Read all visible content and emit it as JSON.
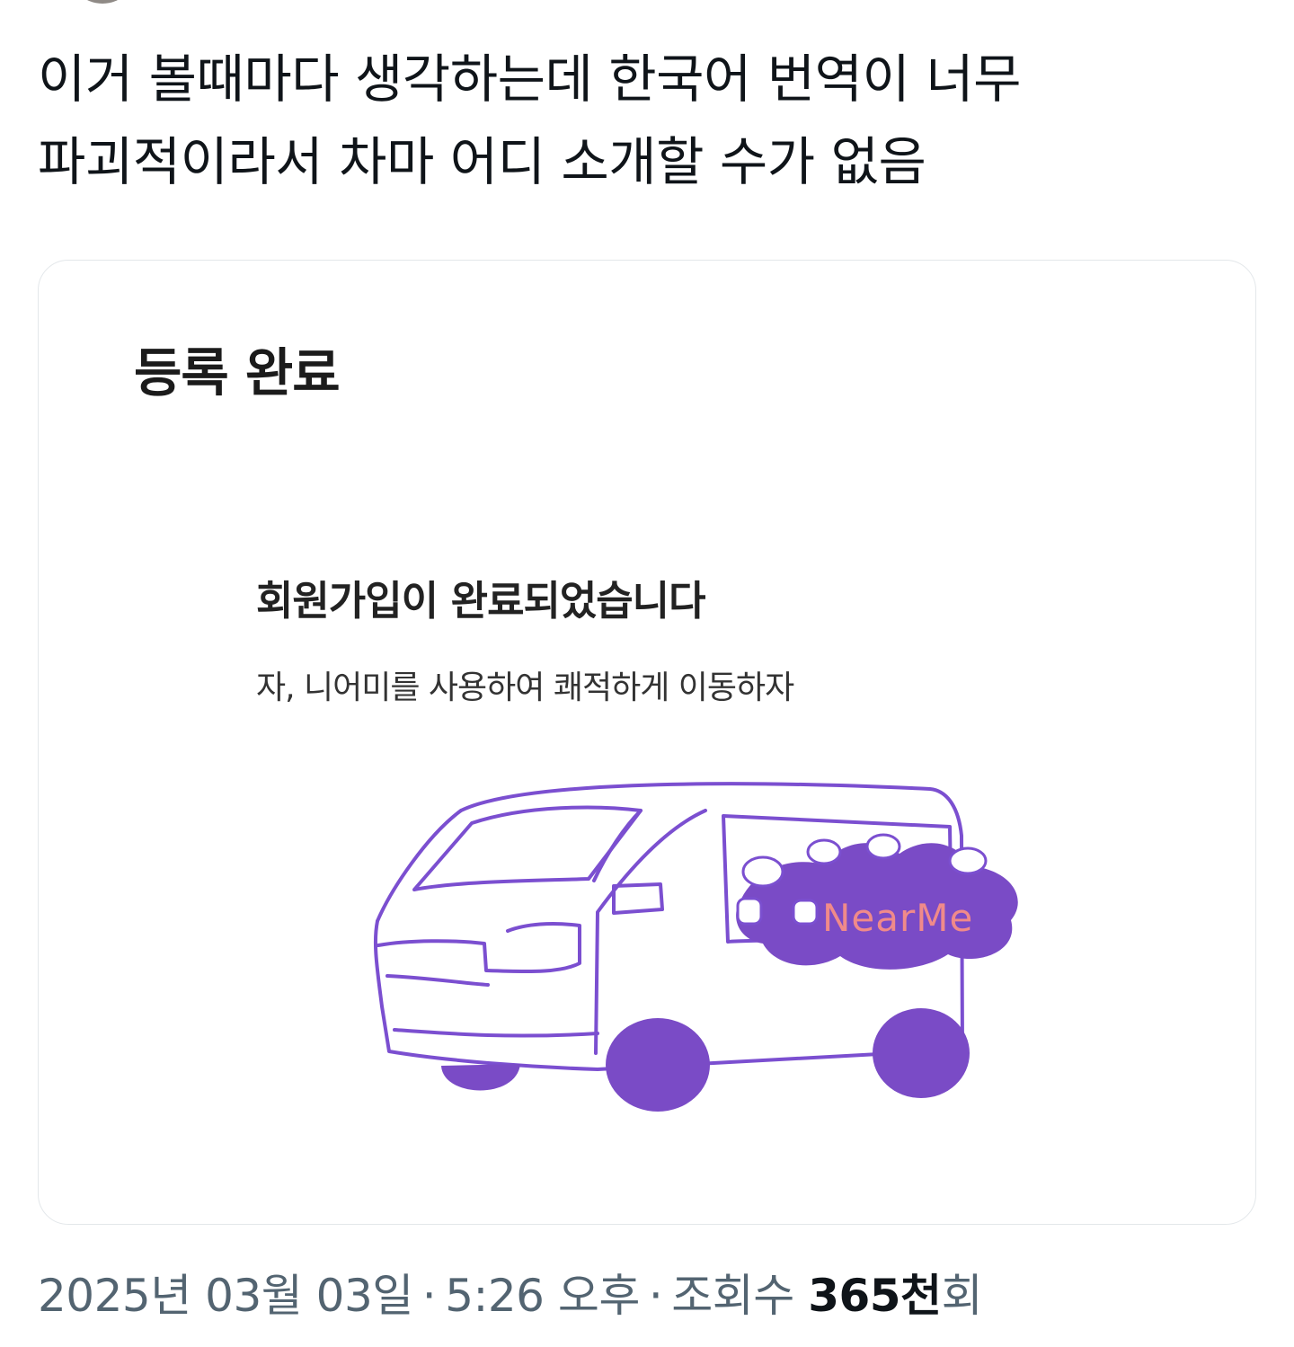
{
  "tweet": {
    "text_line_1": "이거 볼때마다 생각하는데 한국어 번역이 너무",
    "text_line_2": "파괴적이라서 차마 어디 소개할 수가 없음"
  },
  "card": {
    "title": "등록 완료",
    "heading": "회원가입이 완료되었습니다",
    "subtext": "자, 니어미를 사용하여 쾌적하게 이동하자",
    "logo_text": "NearMe"
  },
  "meta": {
    "date": "2025년 03월 03일",
    "separator": "·",
    "time": "5:26 오후",
    "views_label": "조회수",
    "views_count": "365천",
    "views_suffix": "회"
  },
  "colors": {
    "van_outline": "#7b4fd0",
    "van_fill": "#7a4bc6",
    "logo_text": "#f08a8a",
    "meta_text": "#536471"
  }
}
